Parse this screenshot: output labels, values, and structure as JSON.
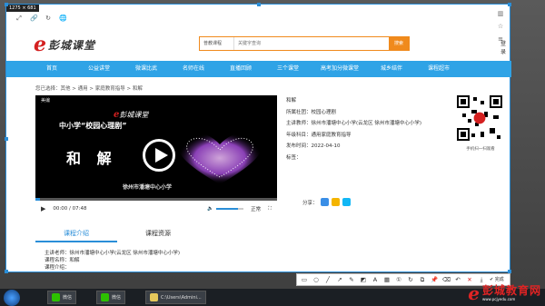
{
  "capture": {
    "size_label": "1275 × 681"
  },
  "browser": {
    "icons": [
      "expand-icon",
      "link-icon",
      "refresh-icon",
      "globe-icon"
    ]
  },
  "header": {
    "logo_mark": "e",
    "logo_text": "彭城课堂",
    "search_category": "普教课程",
    "search_placeholder": "关键字查询",
    "search_button": "搜索",
    "login": "登录"
  },
  "nav": {
    "items": [
      "首页",
      "公益讲堂",
      "微课比武",
      "名师在线",
      "直播回顾",
      "三个课堂",
      "高考加分微课堂",
      "城乡结伴",
      "课程超市"
    ]
  },
  "breadcrumb": "您已选择：其他 > 通用 > 家庭教育指导 > 和解",
  "player": {
    "top_label": "美编",
    "logo_mark": "e",
    "logo_text": "彭城课堂",
    "banner": "中小学“校园心理剧”",
    "big_text": "和 解",
    "school": "徐州市潘塘中心小学",
    "progress": 0.02,
    "time": "00:00 / 07:48",
    "quality": "正常"
  },
  "info": {
    "title": "和解",
    "org": "所属社团：校园心理剧",
    "teacher": "主讲教师：徐州市潘塘中心小学(云龙区 徐州市潘塘中心小学)",
    "grade": "年级科目：通用家庭教育指导",
    "date": "发布时间：2022-04-10",
    "tags": "标签："
  },
  "qr": {
    "caption": "手机扫一扫观看"
  },
  "share": {
    "label": "分享："
  },
  "tabs": {
    "intro": "课程介绍",
    "resources": "课程资源"
  },
  "detail": {
    "teacher": "主讲老师：徐州市潘塘中心小学(云龙区 徐州市潘塘中心小学)",
    "name": "课程名称：和解",
    "desc": "课程介绍："
  },
  "snip_toolbar": {
    "done": "完成"
  },
  "taskbar": {
    "tasks": [
      "微信",
      "微信",
      "C:\\Users\\Admini..."
    ]
  },
  "watermark": {
    "main": "彭城教育网",
    "sub": "www.pcjyedu.com"
  },
  "colors": {
    "nav_blue": "#2fa3e6",
    "accent_orange": "#f08a1c",
    "brand_red": "#d42020"
  }
}
